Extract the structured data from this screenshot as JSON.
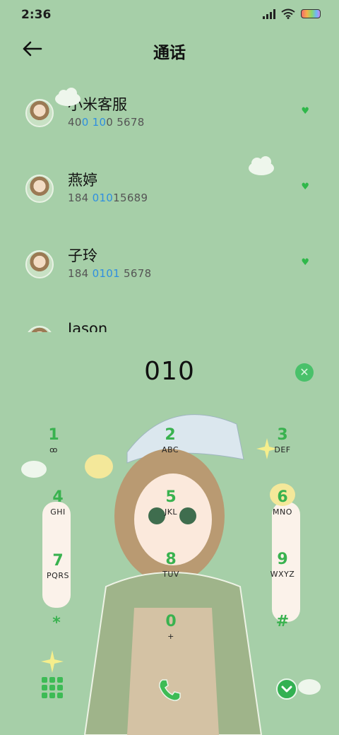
{
  "status_bar": {
    "time": "2:36"
  },
  "header": {
    "title": "通话"
  },
  "contacts": [
    {
      "name": "小米客服",
      "number_parts": [
        "40",
        "0 10",
        "0 5678"
      ]
    },
    {
      "name": "燕婷",
      "number_parts": [
        "184 ",
        "010",
        "15689"
      ]
    },
    {
      "name": "子玲",
      "number_parts": [
        "184 ",
        "0101",
        " 5678"
      ]
    },
    {
      "name": "Jason",
      "number_parts": [
        "",
        "",
        ""
      ]
    }
  ],
  "dialer": {
    "number": "010",
    "keys": [
      {
        "digit": "1",
        "letters": "ꝏ"
      },
      {
        "digit": "2",
        "letters": "ABC"
      },
      {
        "digit": "3",
        "letters": "DEF"
      },
      {
        "digit": "4",
        "letters": "GHI"
      },
      {
        "digit": "5",
        "letters": "JKL"
      },
      {
        "digit": "6",
        "letters": "MNO"
      },
      {
        "digit": "7",
        "letters": "PQRS"
      },
      {
        "digit": "8",
        "letters": "TUV"
      },
      {
        "digit": "9",
        "letters": "WXYZ"
      },
      {
        "digit": "*",
        "letters": ""
      },
      {
        "digit": "0",
        "letters": "+"
      },
      {
        "digit": "#",
        "letters": ""
      }
    ]
  },
  "colors": {
    "background": "#a6cfa8",
    "accent": "#39b24f",
    "highlight": "#2f8fe0"
  }
}
